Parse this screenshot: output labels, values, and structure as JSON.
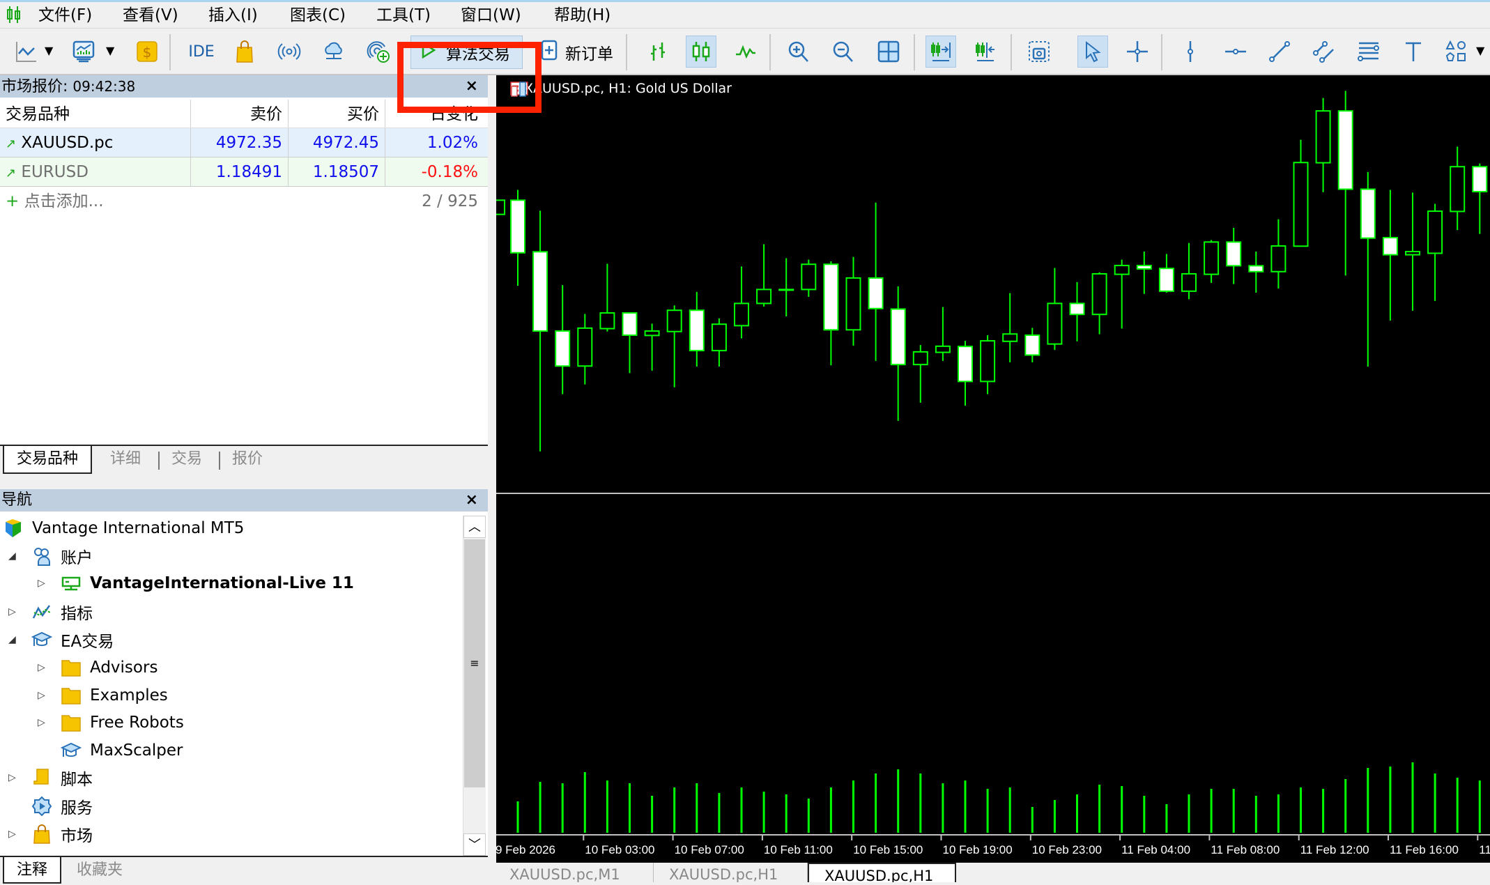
{
  "menu": {
    "items": [
      "文件(F)",
      "查看(V)",
      "插入(I)",
      "图表(C)",
      "工具(T)",
      "窗口(W)",
      "帮助(H)"
    ]
  },
  "toolbar": {
    "ide_label": "IDE",
    "algo_trading_label": "算法交易",
    "new_order_label": "新订单",
    "highlight_color": "#ff2200",
    "icons": [
      "line-chart-icon",
      "chart-template-icon",
      "dollar-icon",
      "ide-icon",
      "market-bag-icon",
      "signals-icon",
      "vps-cloud-icon",
      "add-account-icon",
      "algo-play-icon",
      "new-order-icon",
      "bar-chart-icon",
      "candlestick-icon",
      "line-icon",
      "zoom-in-icon",
      "zoom-out-icon",
      "tile-windows-icon",
      "autoscroll-icon",
      "chart-shift-icon",
      "screenshot-icon",
      "cursor-icon",
      "crosshair-icon",
      "vertical-line-icon",
      "horizontal-line-icon",
      "trendline-icon",
      "channel-icon",
      "fibonacci-icon",
      "text-icon",
      "shapes-icon"
    ]
  },
  "market_watch": {
    "title": "市场报价:",
    "time": "09:42:38",
    "columns": [
      "交易品种",
      "卖价",
      "买价",
      "日变化"
    ],
    "rows": [
      {
        "symbol": "XAUUSD.pc",
        "bid": "4972.35",
        "ask": "4972.45",
        "change": "1.02%"
      },
      {
        "symbol": "EURUSD",
        "bid": "1.18491",
        "ask": "1.18507",
        "change": "-0.18%"
      }
    ],
    "add_label": "点击添加...",
    "count": "2 / 925",
    "tabs": [
      "交易品种",
      "详细",
      "交易",
      "报价"
    ]
  },
  "navigator": {
    "title": "导航",
    "root": "Vantage International MT5",
    "items": [
      "账户",
      "VantageInternational-Live 11",
      "指标",
      "EA交易",
      "Advisors",
      "Examples",
      "Free Robots",
      "MaxScalper",
      "脚本",
      "服务",
      "市场"
    ],
    "tabs": [
      "注释",
      "收藏夹"
    ]
  },
  "chart": {
    "title": "XAUUSD.pc, H1:  Gold US Dollar",
    "tabs": [
      "XAUUSD.pc,M1",
      "XAUUSD.pc,H1",
      "XAUUSD.pc,H1"
    ],
    "active_tab": 2
  },
  "chart_data": {
    "type": "candlestick",
    "symbol": "XAUUSD.pc",
    "timeframe": "H1",
    "bull_color": "#00ff00",
    "bear_fill": "#ffffff",
    "x_tick_labels": [
      "9 Feb 2026",
      "10 Feb 03:00",
      "10 Feb 07:00",
      "10 Feb 11:00",
      "10 Feb 15:00",
      "10 Feb 19:00",
      "10 Feb 23:00",
      "11 Feb 04:00",
      "11 Feb 08:00",
      "11 Feb 12:00",
      "11 Feb 16:00",
      "11"
    ],
    "ohlc": [
      [
        4963.05,
        4968.85,
        4963.05,
        4968.85
      ],
      [
        4968.85,
        4973.05,
        4933.85,
        4947.35
      ],
      [
        4947.75,
        4964.55,
        4866.15,
        4915.35
      ],
      [
        4915.35,
        4934.15,
        4889.55,
        4901.05
      ],
      [
        4901.05,
        4922.35,
        4893.55,
        4916.55
      ],
      [
        4916.35,
        4942.85,
        4915.15,
        4922.75
      ],
      [
        4922.75,
        4922.75,
        4898.15,
        4913.65
      ],
      [
        4913.55,
        4918.35,
        4899.15,
        4915.35
      ],
      [
        4915.15,
        4925.85,
        4892.35,
        4923.85
      ],
      [
        4923.85,
        4931.35,
        4900.85,
        4907.35
      ],
      [
        4907.35,
        4920.55,
        4900.85,
        4918.15
      ],
      [
        4917.55,
        4941.75,
        4912.35,
        4926.65
      ],
      [
        4926.65,
        4950.85,
        4925.35,
        4932.35
      ],
      [
        4932.35,
        4945.15,
        4921.35,
        4932.35
      ],
      [
        4932.35,
        4944.55,
        4929.35,
        4942.65
      ],
      [
        4942.65,
        4943.85,
        4901.35,
        4915.85
      ],
      [
        4915.85,
        4945.65,
        4909.35,
        4937.05
      ],
      [
        4937.05,
        4967.85,
        4903.15,
        4924.55
      ],
      [
        4924.35,
        4933.65,
        4878.65,
        4901.65
      ],
      [
        4901.65,
        4909.65,
        4886.05,
        4906.85
      ],
      [
        4906.65,
        4925.15,
        4903.15,
        4909.15
      ],
      [
        4909.05,
        4911.35,
        4884.85,
        4894.75
      ],
      [
        4894.75,
        4913.65,
        4889.55,
        4911.35
      ],
      [
        4911.15,
        4930.85,
        4902.55,
        4914.15
      ],
      [
        4913.65,
        4916.65,
        4902.55,
        4905.55
      ],
      [
        4910.05,
        4941.15,
        4907.65,
        4926.65
      ],
      [
        4926.65,
        4935.35,
        4911.15,
        4922.15
      ],
      [
        4922.15,
        4939.35,
        4914.05,
        4938.75
      ],
      [
        4938.55,
        4944.55,
        4916.35,
        4942.15
      ],
      [
        4942.15,
        4947.85,
        4930.55,
        4940.75
      ],
      [
        4940.95,
        4946.85,
        4931.05,
        4931.65
      ],
      [
        4931.65,
        4951.35,
        4928.35,
        4938.75
      ],
      [
        4938.55,
        4952.55,
        4935.05,
        4951.75
      ],
      [
        4951.75,
        4957.55,
        4934.55,
        4942.05
      ],
      [
        4942.05,
        4947.85,
        4931.05,
        4939.65
      ],
      [
        4939.65,
        4961.05,
        4932.75,
        4950.15
      ],
      [
        4950.05,
        4993.55,
        4950.05,
        4984.25
      ],
      [
        4984.15,
        5010.65,
        4972.15,
        5005.35
      ],
      [
        5005.35,
        5013.55,
        4938.05,
        4973.35
      ],
      [
        4973.35,
        4980.35,
        4900.85,
        4953.35
      ],
      [
        4953.55,
        4973.05,
        4919.65,
        4946.55
      ],
      [
        4946.55,
        4971.95,
        4923.65,
        4947.85
      ],
      [
        4947.15,
        4967.35,
        4927.65,
        4964.35
      ],
      [
        4964.25,
        4990.75,
        4956.65,
        4982.55
      ],
      [
        4982.55,
        4983.85,
        4955.05,
        4972.35
      ]
    ],
    "volumes": [
      null,
      135,
      219,
      213,
      261,
      225,
      213,
      159,
      195,
      213,
      171,
      195,
      177,
      165,
      147,
      195,
      225,
      255,
      273,
      255,
      213,
      225,
      189,
      195,
      111,
      141,
      165,
      207,
      201,
      159,
      123,
      165,
      189,
      189,
      159,
      165,
      195,
      189,
      231,
      279,
      285,
      303,
      255,
      237,
      225
    ]
  }
}
